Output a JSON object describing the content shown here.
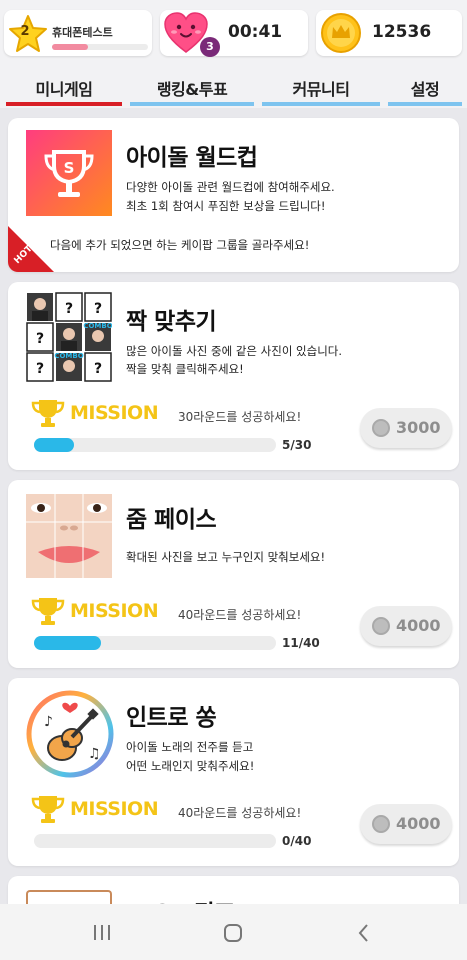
{
  "header": {
    "level": "2",
    "nickname": "휴대폰테스트",
    "xp_fraction": 0.38,
    "hearts": "3",
    "timer": "00:41",
    "coins": "12536"
  },
  "tabs": [
    {
      "label": "미니게임",
      "active": true
    },
    {
      "label": "랭킹&투표",
      "active": false
    },
    {
      "label": "커뮤니티",
      "active": false
    },
    {
      "label": "설정",
      "active": false
    }
  ],
  "games": [
    {
      "title": "아이돌 월드컵",
      "desc1": "다양한 아이돌 관련 월드컵에 참여해주세요.",
      "desc2": "최초 1회 참여시 푸짐한 보상을 드립니다!",
      "desc3": "다음에 추가 되었으면 하는 케이팝 그룹을 골라주세요!",
      "badge": "HOT"
    },
    {
      "title": "짝 맞추기",
      "desc1": "많은 아이돌 사진 중에 같은 사진이 있습니다.",
      "desc2": "짝을 맞춰 클릭해주세요!",
      "thumb_marks": [
        "?",
        "?",
        "?",
        "?",
        "?",
        "?"
      ],
      "thumb_combo": "COMBO",
      "mission_label": "MISSION",
      "mission_text": "30라운드를 성공하세요!",
      "progress": 0.1667,
      "progress_text": "5/30",
      "reward": "3000"
    },
    {
      "title": "줌 페이스",
      "desc1": "확대된 사진을 보고 누구인지 맞춰보세요!",
      "mission_label": "MISSION",
      "mission_text": "40라운드를 성공하세요!",
      "progress": 0.275,
      "progress_text": "11/40",
      "reward": "4000"
    },
    {
      "title": "인트로 쏭",
      "desc1": "아이돌 노래의 전주를  듣고",
      "desc2": "어떤 노래인지 맞춰주세요!",
      "mission_label": "MISSION",
      "mission_text": "40라운드를 성공하세요!",
      "progress": 0,
      "progress_text": "0/40",
      "reward": "4000"
    },
    {
      "title": "IDOL 퀴즈"
    }
  ],
  "colors": {
    "accent_red": "#d81f26",
    "tab_blue": "#7ec4ef",
    "progress_blue": "#2ab8e8",
    "mission_gold": "#f4c417"
  },
  "icons": [
    "star-icon",
    "heart-icon",
    "crown-coin-icon",
    "trophy-icon",
    "coin-icon",
    "guitar-icon"
  ]
}
